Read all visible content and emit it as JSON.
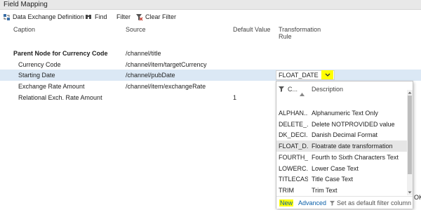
{
  "window": {
    "title": "Field Mapping"
  },
  "toolbar": {
    "data_exchange_label": "Data Exchange Definition",
    "find_label": "Find",
    "filter_label": "Filter",
    "clear_filter_label": "Clear Filter"
  },
  "columns": {
    "caption": "Caption",
    "source": "Source",
    "default_value": "Default Value",
    "transformation_rule_line1": "Transformation",
    "transformation_rule_line2": "Rule"
  },
  "rows": [
    {
      "caption": "Parent Node for Currency Code",
      "source": "/channel/title",
      "default": "",
      "rule": ""
    },
    {
      "caption": "Currency Code",
      "source": "/channel/item/targetCurrency",
      "default": "",
      "rule": ""
    },
    {
      "caption": "Starting Date",
      "source": "/channel/pubDate",
      "default": "",
      "rule": "FLOAT_DATE"
    },
    {
      "caption": "Exchange Rate Amount",
      "source": "/channel/item/exchangeRate",
      "default": "",
      "rule": ""
    },
    {
      "caption": "Relational Exch. Rate Amount",
      "source": "",
      "default": "1",
      "rule": ""
    }
  ],
  "lookup": {
    "col_code": "C...",
    "col_description": "Description",
    "items": [
      {
        "code": "ALPHAN...",
        "description": "Alphanumeric Text Only"
      },
      {
        "code": "DELETE_...",
        "description": "Delete NOTPROVIDED value"
      },
      {
        "code": "DK_DECI...",
        "description": "Danish Decimal Format"
      },
      {
        "code": "FLOAT_D...",
        "description": "Floatrate date transformation"
      },
      {
        "code": "FOURTH_...",
        "description": "Fourth to Sixth Characters Text"
      },
      {
        "code": "LOWERC...",
        "description": "Lower Case Text"
      },
      {
        "code": "TITLECASE",
        "description": "Title Case Text"
      },
      {
        "code": "TRIM",
        "description": "Trim Text"
      }
    ],
    "footer": {
      "new_label": "New",
      "advanced_label": "Advanced",
      "default_filter_label": "Set as default filter column"
    }
  },
  "ok_clip": "OK",
  "colors": {
    "highlight_yellow": "#ffff00",
    "selected_row": "#dbe8f5",
    "link_blue": "#0a5fa8"
  }
}
